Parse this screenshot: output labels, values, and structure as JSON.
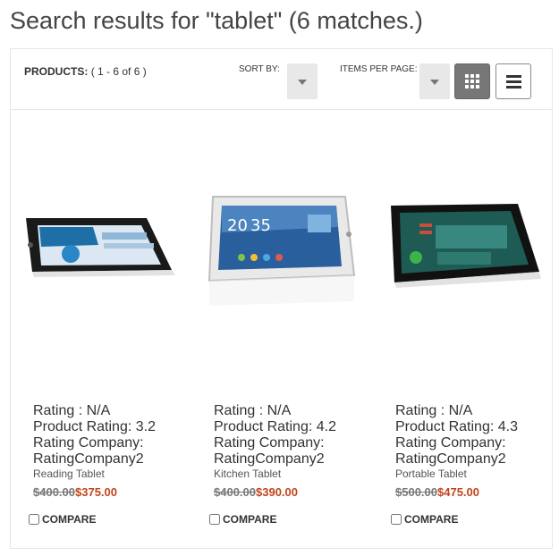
{
  "header": {
    "title": "Search results for \"tablet\" (6 matches.)"
  },
  "toolbar": {
    "products_label": "PRODUCTS:",
    "products_range": "( 1 - 6 of 6 )",
    "sort_label": "SORT BY:",
    "ipp_label": "ITEMS PER PAGE:",
    "grid_icon": "grid-view-icon",
    "list_icon": "list-view-icon"
  },
  "products": [
    {
      "rating": "Rating : N/A",
      "product_rating": "Product Rating: 3.2",
      "rating_company_label": "Rating Company:",
      "rating_company": "RatingCompany2",
      "name": "Reading Tablet",
      "old_price": "$400.00",
      "new_price": "$375.00",
      "compare": "COMPARE"
    },
    {
      "rating": "Rating : N/A",
      "product_rating": "Product Rating: 4.2",
      "rating_company_label": "Rating Company:",
      "rating_company": "RatingCompany2",
      "name": "Kitchen Tablet",
      "old_price": "$400.00",
      "new_price": "$390.00",
      "compare": "COMPARE"
    },
    {
      "rating": "Rating : N/A",
      "product_rating": "Product Rating: 4.3",
      "rating_company_label": "Rating Company:",
      "rating_company": "RatingCompany2",
      "name": "Portable Tablet",
      "old_price": "$500.00",
      "new_price": "$475.00",
      "compare": "COMPARE"
    }
  ],
  "thumb_clock": {
    "time_hour": "20",
    "time_min": "35"
  },
  "colors": {
    "accent_price": "#c0451d"
  }
}
